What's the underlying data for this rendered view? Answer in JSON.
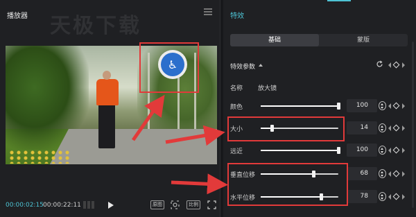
{
  "player": {
    "title": "播放器",
    "watermark": "天极下载",
    "time_current": "00:00:02:15",
    "time_total": "00:00:22:11",
    "btn_original": "原图",
    "btn_ratio": "比例",
    "sign_symbol": "♿"
  },
  "effects": {
    "title": "特效",
    "tabs": [
      {
        "label": "基础",
        "active": true
      },
      {
        "label": "蒙版",
        "active": false
      }
    ],
    "section_title": "特效参数",
    "name_label": "名称",
    "name_value": "放大镜",
    "params": [
      {
        "label": "颜色",
        "value": "100",
        "fraction": 1.0
      },
      {
        "label": "大小",
        "value": "14",
        "fraction": 0.14
      },
      {
        "label": "远近",
        "value": "100",
        "fraction": 1.0
      },
      {
        "label": "垂直位移",
        "value": "68",
        "fraction": 0.68
      },
      {
        "label": "水平位移",
        "value": "78",
        "fraction": 0.78
      }
    ]
  },
  "colors": {
    "accent": "#4ec3d4",
    "highlight": "#e23a3a",
    "panel_bg": "#1f2023"
  },
  "icons": [
    "menu-icon",
    "play-icon",
    "grid-icon",
    "original-icon",
    "fit-icon",
    "ratio-icon",
    "fullscreen-icon",
    "reset-icon",
    "stepper-icon",
    "keyframe-prev-icon",
    "keyframe-diamond-icon",
    "keyframe-next-icon",
    "caret-up-icon"
  ]
}
